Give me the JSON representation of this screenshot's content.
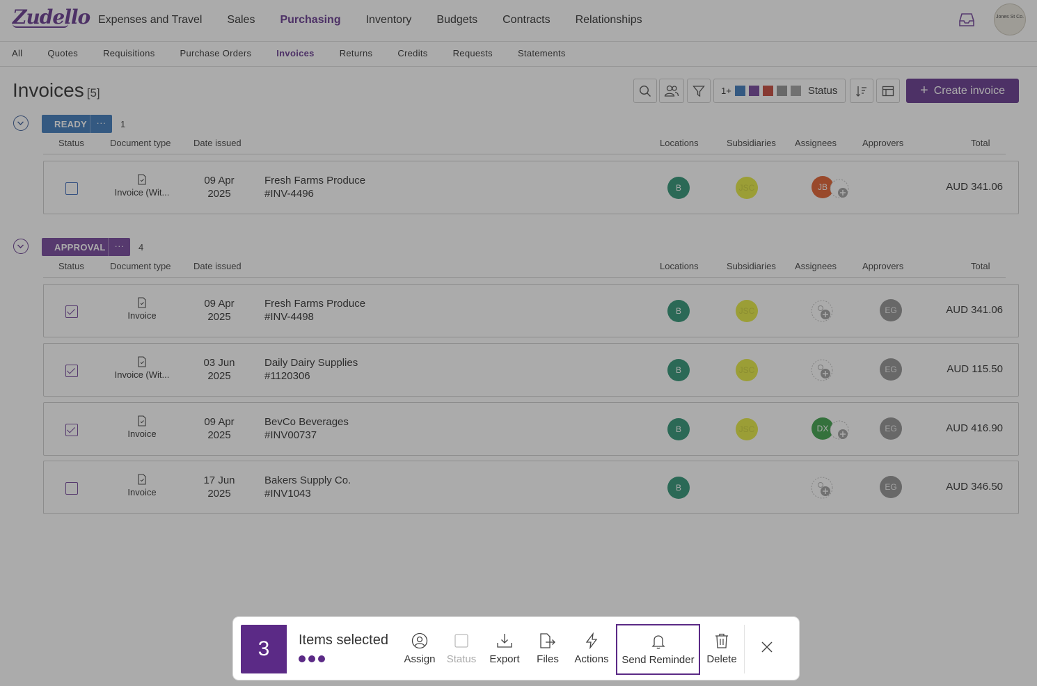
{
  "app": {
    "logo": "Zudello",
    "org_avatar": "Jones St Co."
  },
  "topnav": [
    {
      "label": "Expenses and Travel",
      "active": false
    },
    {
      "label": "Sales",
      "active": false
    },
    {
      "label": "Purchasing",
      "active": true
    },
    {
      "label": "Inventory",
      "active": false
    },
    {
      "label": "Budgets",
      "active": false
    },
    {
      "label": "Contracts",
      "active": false
    },
    {
      "label": "Relationships",
      "active": false
    }
  ],
  "subnav": [
    {
      "label": "All",
      "active": false
    },
    {
      "label": "Quotes",
      "active": false
    },
    {
      "label": "Requisitions",
      "active": false
    },
    {
      "label": "Purchase Orders",
      "active": false
    },
    {
      "label": "Invoices",
      "active": true
    },
    {
      "label": "Returns",
      "active": false
    },
    {
      "label": "Credits",
      "active": false
    },
    {
      "label": "Requests",
      "active": false
    },
    {
      "label": "Statements",
      "active": false
    }
  ],
  "header": {
    "title": "Invoices",
    "count": "[5]",
    "status_filter_prefix": "1+",
    "status_filter_label": "Status",
    "status_colors": [
      "#2f6fb5",
      "#6a3895",
      "#c0392b",
      "#8a8a8a",
      "#8a8a8a"
    ],
    "create_label": "Create invoice"
  },
  "columns": {
    "status": "Status",
    "doctype": "Document type",
    "date": "Date issued",
    "locations": "Locations",
    "subsidiaries": "Subsidiaries",
    "assignees": "Assignees",
    "approvers": "Approvers",
    "total": "Total"
  },
  "groups": [
    {
      "label": "READY",
      "count": "1",
      "color": "#2f6fb5",
      "rows": [
        {
          "checked": false,
          "doctype": "Invoice (Wit...",
          "date1": "09 Apr",
          "date2": "2025",
          "supplier": "Fresh Farms Produce",
          "ref": "#INV-4496",
          "location": "B",
          "subsidiary": "JSC",
          "assignee": "JB",
          "assignee_color": "#e0531f",
          "approver": "",
          "total": "AUD 341.06"
        }
      ]
    },
    {
      "label": "APPROVAL",
      "count": "4",
      "color": "#6a3895",
      "rows": [
        {
          "checked": true,
          "doctype": "Invoice",
          "date1": "09 Apr",
          "date2": "2025",
          "supplier": "Fresh Farms Produce",
          "ref": "#INV-4498",
          "location": "B",
          "subsidiary": "JSC",
          "assignee": "",
          "approver": "EG",
          "total": "AUD 341.06"
        },
        {
          "checked": true,
          "doctype": "Invoice (Wit...",
          "date1": "03 Jun",
          "date2": "2025",
          "supplier": "Daily Dairy Supplies",
          "ref": "#1120306",
          "location": "B",
          "subsidiary": "JSC",
          "assignee": "",
          "approver": "EG",
          "total": "AUD 115.50"
        },
        {
          "checked": true,
          "doctype": "Invoice",
          "date1": "09 Apr",
          "date2": "2025",
          "supplier": "BevCo Beverages",
          "ref": "#INV00737",
          "location": "B",
          "subsidiary": "JSC",
          "assignee": "DX",
          "assignee_color": "#2e9a3c",
          "approver": "EG",
          "total": "AUD 416.90"
        },
        {
          "checked": false,
          "doctype": "Invoice",
          "date1": "17 Jun",
          "date2": "2025",
          "supplier": "Bakers Supply Co.",
          "ref": "#INV1043",
          "location": "B",
          "subsidiary": "",
          "assignee": "",
          "approver": "EG",
          "total": "AUD 346.50"
        }
      ]
    }
  ],
  "actionbar": {
    "count": "3",
    "label": "Items selected",
    "actions": [
      {
        "label": "Assign",
        "icon": "user-circle-icon",
        "disabled": false
      },
      {
        "label": "Status",
        "icon": "square-icon",
        "disabled": true
      },
      {
        "label": "Export",
        "icon": "download-icon",
        "disabled": false
      },
      {
        "label": "Files",
        "icon": "file-export-icon",
        "disabled": false
      },
      {
        "label": "Actions",
        "icon": "lightning-icon",
        "disabled": false
      },
      {
        "label": "Send Reminder",
        "icon": "bell-icon",
        "disabled": false,
        "highlighted": true
      },
      {
        "label": "Delete",
        "icon": "trash-icon",
        "disabled": false
      }
    ]
  }
}
